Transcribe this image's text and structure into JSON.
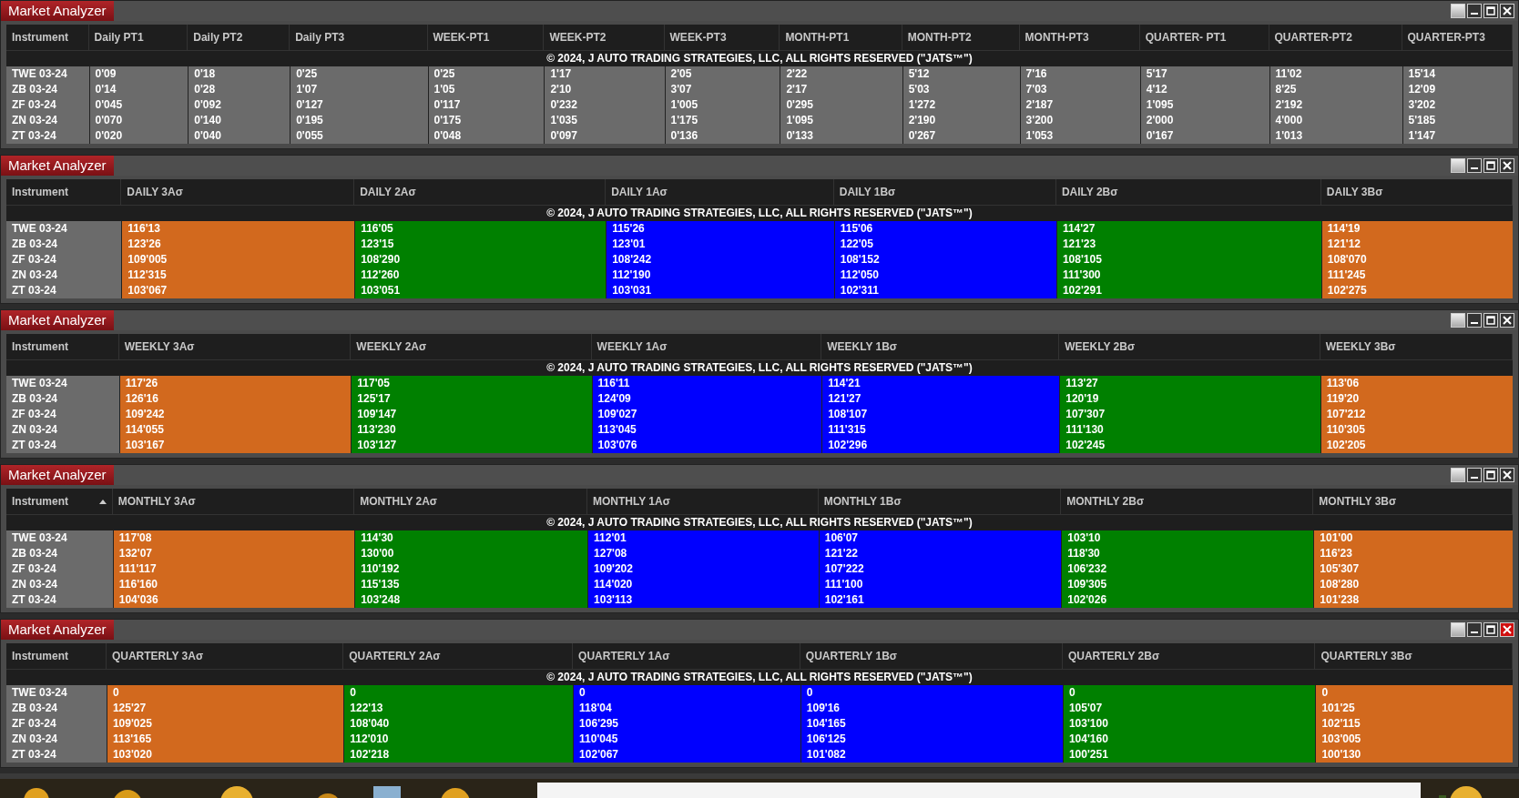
{
  "panels": [
    {
      "title": "Market Analyzer",
      "focused": false,
      "copyright": "© 2024, J AUTO TRADING STRATEGIES, LLC, ALL RIGHTS RESERVED (\"JATS™\")",
      "columns": [
        {
          "label": "Instrument",
          "sorted": false
        },
        {
          "label": "Daily PT1",
          "sorted": false
        },
        {
          "label": "Daily PT2",
          "sorted": false
        },
        {
          "label": "Daily PT3",
          "sorted": false
        },
        {
          "label": "WEEK-PT1",
          "sorted": false
        },
        {
          "label": "WEEK-PT2",
          "sorted": false
        },
        {
          "label": "WEEK-PT3",
          "sorted": false
        },
        {
          "label": "MONTH-PT1",
          "sorted": false
        },
        {
          "label": "MONTH-PT2",
          "sorted": false
        },
        {
          "label": "MONTH-PT3",
          "sorted": false
        },
        {
          "label": "QUARTER- PT1",
          "sorted": false
        },
        {
          "label": "QUARTER-PT2",
          "sorted": false
        },
        {
          "label": "QUARTER-PT3",
          "sorted": false
        }
      ],
      "rows": [
        {
          "instrument": "TWE 03-24",
          "values": [
            "0'09",
            "0'18",
            "0'25",
            "0'25",
            "1'17",
            "2'05",
            "2'22",
            "5'12",
            "7'16",
            "5'17",
            "11'02",
            "15'14"
          ]
        },
        {
          "instrument": "ZB 03-24",
          "values": [
            "0'14",
            "0'28",
            "1'07",
            "1'05",
            "2'10",
            "3'07",
            "2'17",
            "5'03",
            "7'03",
            "4'12",
            "8'25",
            "12'09"
          ]
        },
        {
          "instrument": "ZF 03-24",
          "values": [
            "0'045",
            "0'092",
            "0'127",
            "0'117",
            "0'232",
            "1'005",
            "0'295",
            "1'272",
            "2'187",
            "1'095",
            "2'192",
            "3'202"
          ]
        },
        {
          "instrument": "ZN 03-24",
          "values": [
            "0'070",
            "0'140",
            "0'195",
            "0'175",
            "1'035",
            "1'175",
            "1'095",
            "2'190",
            "3'200",
            "2'000",
            "4'000",
            "5'185"
          ]
        },
        {
          "instrument": "ZT 03-24",
          "values": [
            "0'020",
            "0'040",
            "0'055",
            "0'048",
            "0'097",
            "0'136",
            "0'133",
            "0'267",
            "1'053",
            "0'167",
            "1'013",
            "1'147"
          ]
        }
      ]
    },
    {
      "title": "Market Analyzer",
      "focused": false,
      "copyright": "© 2024, J AUTO TRADING STRATEGIES, LLC, ALL RIGHTS RESERVED (\"JATS™\")",
      "columns": [
        {
          "label": "Instrument",
          "sorted": false
        },
        {
          "label": "DAILY 3Aσ",
          "sorted": false,
          "color": "#d2691e"
        },
        {
          "label": "DAILY 2Aσ",
          "sorted": false,
          "color": "#008000"
        },
        {
          "label": "DAILY 1Aσ",
          "sorted": false,
          "color": "#0000ff"
        },
        {
          "label": "DAILY 1Bσ",
          "sorted": false,
          "color": "#0000ff"
        },
        {
          "label": "DAILY 2Bσ",
          "sorted": false,
          "color": "#008000"
        },
        {
          "label": "DAILY 3Bσ",
          "sorted": false,
          "color": "#d2691e"
        }
      ],
      "rows": [
        {
          "instrument": "TWE 03-24",
          "values": [
            "116'13",
            "116'05",
            "115'26",
            "115'06",
            "114'27",
            "114'19"
          ]
        },
        {
          "instrument": "ZB 03-24",
          "values": [
            "123'26",
            "123'15",
            "123'01",
            "122'05",
            "121'23",
            "121'12"
          ]
        },
        {
          "instrument": "ZF 03-24",
          "values": [
            "109'005",
            "108'290",
            "108'242",
            "108'152",
            "108'105",
            "108'070"
          ]
        },
        {
          "instrument": "ZN 03-24",
          "values": [
            "112'315",
            "112'260",
            "112'190",
            "112'050",
            "111'300",
            "111'245"
          ]
        },
        {
          "instrument": "ZT 03-24",
          "values": [
            "103'067",
            "103'051",
            "103'031",
            "102'311",
            "102'291",
            "102'275"
          ]
        }
      ]
    },
    {
      "title": "Market Analyzer",
      "focused": false,
      "copyright": "© 2024, J AUTO TRADING STRATEGIES, LLC, ALL RIGHTS RESERVED (\"JATS™\")",
      "columns": [
        {
          "label": "Instrument",
          "sorted": false
        },
        {
          "label": "WEEKLY 3Aσ",
          "sorted": false,
          "color": "#d2691e"
        },
        {
          "label": "WEEKLY 2Aσ",
          "sorted": false,
          "color": "#008000"
        },
        {
          "label": "WEEKLY 1Aσ",
          "sorted": false,
          "color": "#0000ff"
        },
        {
          "label": "WEEKLY 1Bσ",
          "sorted": false,
          "color": "#0000ff"
        },
        {
          "label": "WEEKLY 2Bσ",
          "sorted": false,
          "color": "#008000"
        },
        {
          "label": "WEEKLY 3Bσ",
          "sorted": false,
          "color": "#d2691e"
        }
      ],
      "rows": [
        {
          "instrument": "TWE 03-24",
          "values": [
            "117'26",
            "117'05",
            "116'11",
            "114'21",
            "113'27",
            "113'06"
          ]
        },
        {
          "instrument": "ZB 03-24",
          "values": [
            "126'16",
            "125'17",
            "124'09",
            "121'27",
            "120'19",
            "119'20"
          ]
        },
        {
          "instrument": "ZF 03-24",
          "values": [
            "109'242",
            "109'147",
            "109'027",
            "108'107",
            "107'307",
            "107'212"
          ]
        },
        {
          "instrument": "ZN 03-24",
          "values": [
            "114'055",
            "113'230",
            "113'045",
            "111'315",
            "111'130",
            "110'305"
          ]
        },
        {
          "instrument": "ZT 03-24",
          "values": [
            "103'167",
            "103'127",
            "103'076",
            "102'296",
            "102'245",
            "102'205"
          ]
        }
      ]
    },
    {
      "title": "Market Analyzer",
      "focused": false,
      "copyright": "© 2024, J AUTO TRADING STRATEGIES, LLC, ALL RIGHTS RESERVED (\"JATS™\")",
      "columns": [
        {
          "label": "Instrument",
          "sorted": true
        },
        {
          "label": "MONTHLY 3Aσ",
          "sorted": false,
          "color": "#d2691e"
        },
        {
          "label": "MONTHLY 2Aσ",
          "sorted": false,
          "color": "#008000"
        },
        {
          "label": "MONTHLY 1Aσ",
          "sorted": false,
          "color": "#0000ff"
        },
        {
          "label": "MONTHLY 1Bσ",
          "sorted": false,
          "color": "#0000ff"
        },
        {
          "label": "MONTHLY 2Bσ",
          "sorted": false,
          "color": "#008000"
        },
        {
          "label": "MONTHLY 3Bσ",
          "sorted": false,
          "color": "#d2691e"
        }
      ],
      "rows": [
        {
          "instrument": "TWE 03-24",
          "values": [
            "117'08",
            "114'30",
            "112'01",
            "106'07",
            "103'10",
            "101'00"
          ]
        },
        {
          "instrument": "ZB 03-24",
          "values": [
            "132'07",
            "130'00",
            "127'08",
            "121'22",
            "118'30",
            "116'23"
          ]
        },
        {
          "instrument": "ZF 03-24",
          "values": [
            "111'117",
            "110'192",
            "109'202",
            "107'222",
            "106'232",
            "105'307"
          ]
        },
        {
          "instrument": "ZN 03-24",
          "values": [
            "116'160",
            "115'135",
            "114'020",
            "111'100",
            "109'305",
            "108'280"
          ]
        },
        {
          "instrument": "ZT 03-24",
          "values": [
            "104'036",
            "103'248",
            "103'113",
            "102'161",
            "102'026",
            "101'238"
          ]
        }
      ]
    },
    {
      "title": "Market Analyzer",
      "focused": true,
      "copyright": "© 2024, J AUTO TRADING STRATEGIES, LLC, ALL RIGHTS RESERVED (\"JATS™\")",
      "columns": [
        {
          "label": "Instrument",
          "sorted": false
        },
        {
          "label": "QUARTERLY 3Aσ",
          "sorted": false,
          "color": "#d2691e"
        },
        {
          "label": "QUARTERLY 2Aσ",
          "sorted": false,
          "color": "#008000"
        },
        {
          "label": "QUARTERLY 1Aσ",
          "sorted": false,
          "color": "#0000ff"
        },
        {
          "label": "QUARTERLY 1Bσ",
          "sorted": false,
          "color": "#0000ff"
        },
        {
          "label": "QUARTERLY 2Bσ",
          "sorted": false,
          "color": "#008000"
        },
        {
          "label": "QUARTERLY 3Bσ",
          "sorted": false,
          "color": "#d2691e"
        }
      ],
      "rows": [
        {
          "instrument": "TWE 03-24",
          "values": [
            "0",
            "0",
            "0",
            "0",
            "0",
            "0"
          ]
        },
        {
          "instrument": "ZB 03-24",
          "values": [
            "125'27",
            "122'13",
            "118'04",
            "109'16",
            "105'07",
            "101'25"
          ]
        },
        {
          "instrument": "ZF 03-24",
          "values": [
            "109'025",
            "108'040",
            "106'295",
            "104'165",
            "103'100",
            "102'115"
          ]
        },
        {
          "instrument": "ZN 03-24",
          "values": [
            "113'165",
            "112'010",
            "110'045",
            "106'125",
            "104'160",
            "103'005"
          ]
        },
        {
          "instrument": "ZT 03-24",
          "values": [
            "103'020",
            "102'218",
            "102'067",
            "101'082",
            "100'251",
            "100'130"
          ]
        }
      ]
    }
  ]
}
